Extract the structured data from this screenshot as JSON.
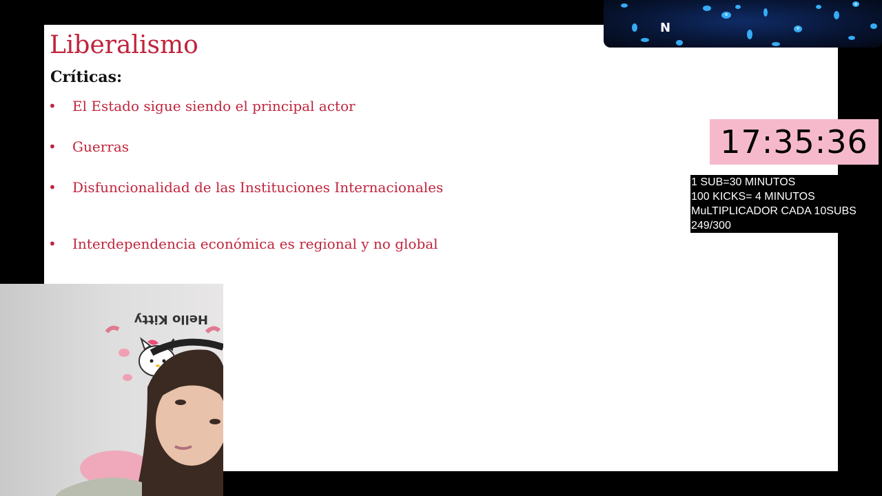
{
  "slide": {
    "title": "Liberalismo",
    "subtitle": "Críticas:",
    "bullet_symbol": "•",
    "bullets": [
      "El Estado sigue siendo el principal actor",
      "Guerras",
      "Disfuncionalidad de las Instituciones Internacionales",
      "Interdependencia económica es regional y no global"
    ],
    "title_color": "#c0243c"
  },
  "overlay": {
    "letter": "N",
    "icon": "neon-bubbles-graphic"
  },
  "timer": {
    "value": "17:35:36",
    "background": "#f6b9cc"
  },
  "rules": {
    "lines": [
      "1 SUB=30 MINUTOS",
      "100 KICKS= 4 MINUTOS",
      "MuLTIPLICADOR CADA 10SUBS",
      "249/300"
    ]
  },
  "webcam": {
    "wall_text": "Hello Kitty",
    "icon": "webcam-feed"
  }
}
